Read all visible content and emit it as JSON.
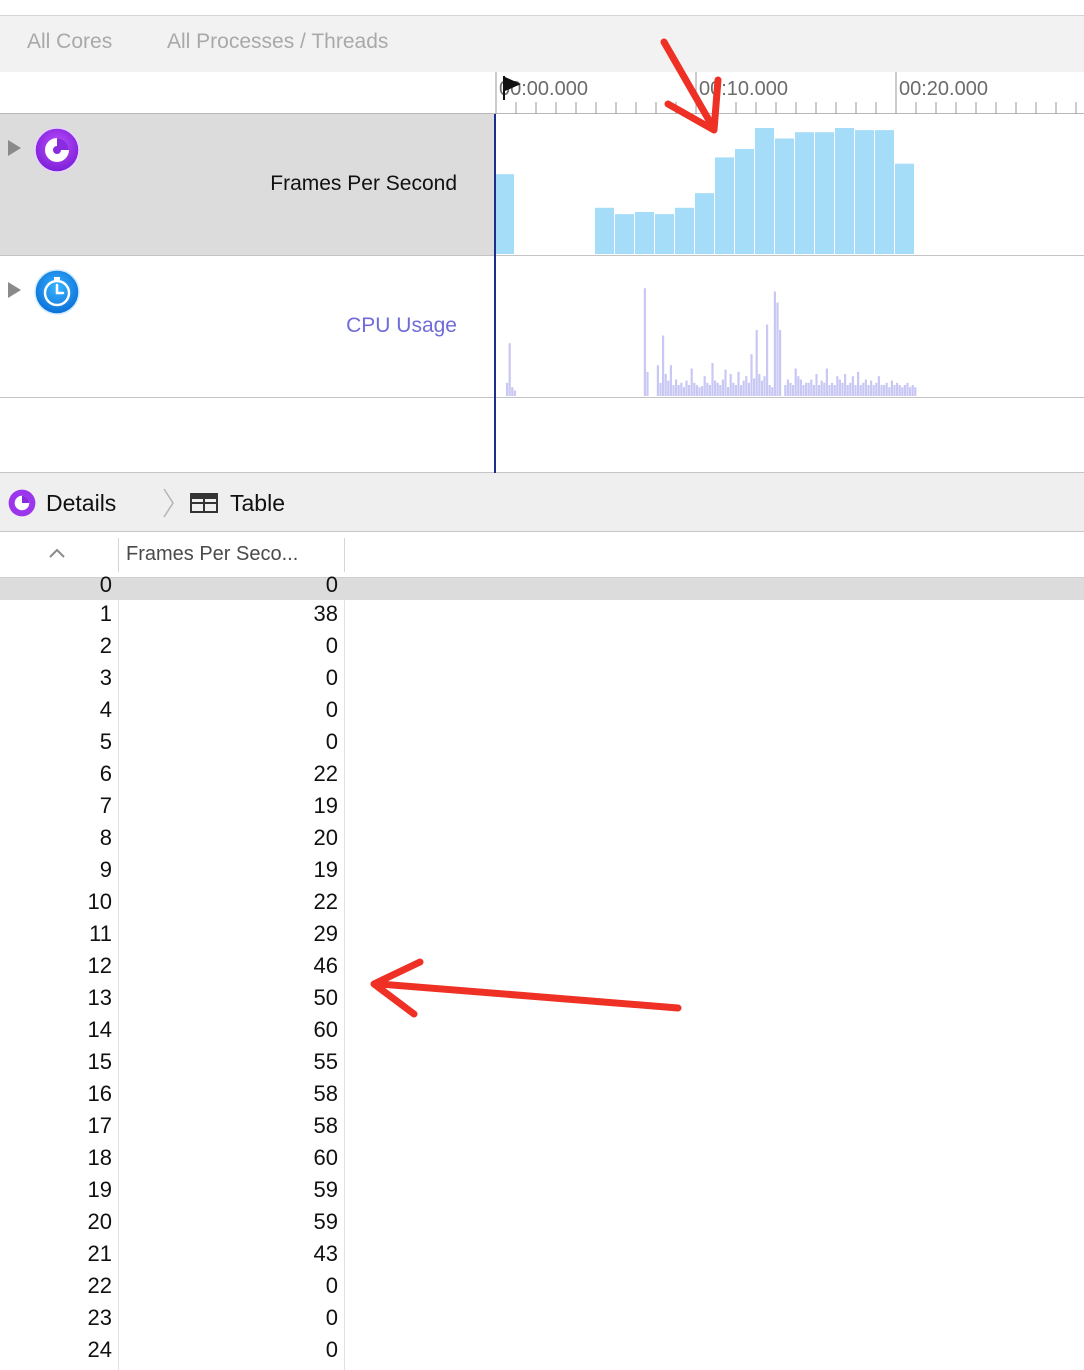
{
  "scope": {
    "cores": "All Cores",
    "processes": "All Processes / Threads"
  },
  "ruler": {
    "ticks": [
      "00:00.000",
      "00:10.000",
      "00:20.000"
    ]
  },
  "tracks": [
    {
      "label": "Frames Per Second",
      "icon": "fps-instrument-icon",
      "color": "#a5dcf7"
    },
    {
      "label": "CPU Usage",
      "icon": "cpu-instrument-icon",
      "color": "#c9c8f5"
    }
  ],
  "details": {
    "crumb_details": "Details",
    "crumb_table": "Table"
  },
  "table": {
    "fps_header": "Frames Per Seco...",
    "rows": [
      {
        "index": "0",
        "fps": "0"
      },
      {
        "index": "1",
        "fps": "38"
      },
      {
        "index": "2",
        "fps": "0"
      },
      {
        "index": "3",
        "fps": "0"
      },
      {
        "index": "4",
        "fps": "0"
      },
      {
        "index": "5",
        "fps": "0"
      },
      {
        "index": "6",
        "fps": "22"
      },
      {
        "index": "7",
        "fps": "19"
      },
      {
        "index": "8",
        "fps": "20"
      },
      {
        "index": "9",
        "fps": "19"
      },
      {
        "index": "10",
        "fps": "22"
      },
      {
        "index": "11",
        "fps": "29"
      },
      {
        "index": "12",
        "fps": "46"
      },
      {
        "index": "13",
        "fps": "50"
      },
      {
        "index": "14",
        "fps": "60"
      },
      {
        "index": "15",
        "fps": "55"
      },
      {
        "index": "16",
        "fps": "58"
      },
      {
        "index": "17",
        "fps": "58"
      },
      {
        "index": "18",
        "fps": "60"
      },
      {
        "index": "19",
        "fps": "59"
      },
      {
        "index": "20",
        "fps": "59"
      },
      {
        "index": "21",
        "fps": "43"
      },
      {
        "index": "22",
        "fps": "0"
      },
      {
        "index": "23",
        "fps": "0"
      },
      {
        "index": "24",
        "fps": "0"
      }
    ]
  },
  "chart_data": [
    {
      "type": "bar",
      "series": [
        {
          "values": [
            38,
            0,
            0,
            0,
            0,
            22,
            19,
            20,
            19,
            22,
            29,
            46,
            50,
            60,
            55,
            58,
            58,
            60,
            59,
            59,
            43,
            0,
            0,
            0,
            0
          ]
        }
      ],
      "x": [
        0,
        1,
        2,
        3,
        4,
        5,
        6,
        7,
        8,
        9,
        10,
        11,
        12,
        13,
        14,
        15,
        16,
        17,
        18,
        19,
        20,
        21,
        22,
        23,
        24
      ],
      "ylim": [
        0,
        60
      ]
    },
    {
      "type": "bar",
      "series": [
        {
          "values": [
            12,
            48,
            8,
            5,
            0,
            0,
            0,
            0,
            0,
            0,
            0,
            0,
            0,
            0,
            0,
            0,
            0,
            0,
            0,
            0,
            0,
            0,
            0,
            0,
            0,
            0,
            0,
            0,
            0,
            0,
            0,
            0,
            0,
            0,
            0,
            0,
            0,
            0,
            0,
            0,
            0,
            0,
            0,
            0,
            0,
            0,
            0,
            0,
            0,
            0,
            0,
            0,
            0,
            98,
            22,
            0,
            0,
            0,
            28,
            12,
            55,
            20,
            14,
            28,
            10,
            15,
            10,
            12,
            8,
            14,
            10,
            25,
            12,
            10,
            8,
            9,
            18,
            12,
            10,
            30,
            14,
            12,
            10,
            15,
            24,
            8,
            20,
            12,
            10,
            22,
            10,
            14,
            18,
            12,
            38,
            16,
            60,
            20,
            14,
            18,
            65,
            10,
            8,
            95,
            85,
            60,
            0,
            10,
            15,
            12,
            10,
            25,
            18,
            15,
            10,
            12,
            12,
            15,
            10,
            20,
            10,
            14,
            12,
            25,
            10,
            12,
            10,
            18,
            15,
            12,
            20,
            10,
            12,
            18,
            10,
            22,
            10,
            12,
            15,
            10,
            14,
            10,
            12,
            18,
            10,
            10,
            12,
            8,
            14,
            10,
            12,
            10,
            8,
            10,
            12,
            8,
            10,
            8
          ]
        }
      ],
      "ylim": [
        0,
        100
      ]
    }
  ]
}
